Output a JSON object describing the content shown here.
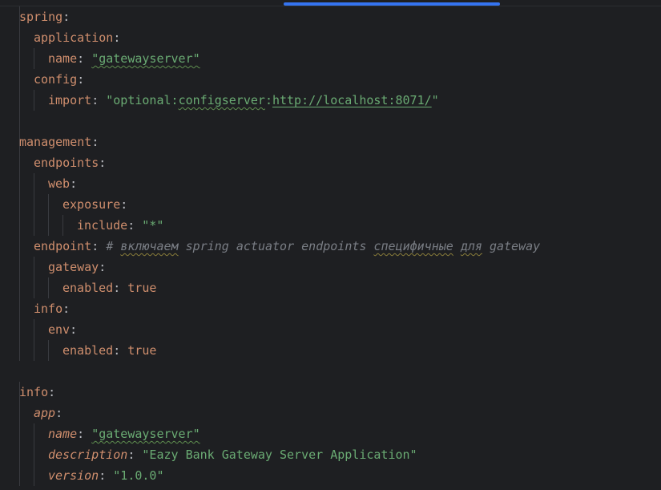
{
  "editor": {
    "accent": "#3574f0",
    "colors": {
      "background": "#1e1f22",
      "key": "#cf8e6d",
      "string": "#6aab73",
      "comment": "#7a7e85",
      "text": "#bcbec4"
    },
    "lines": {
      "l1": {
        "key": "spring"
      },
      "l2": {
        "key": "application"
      },
      "l3": {
        "key": "name",
        "value": "\"gatewayserver\""
      },
      "l4": {
        "key": "config"
      },
      "l5": {
        "key": "import",
        "v_prefix": "\"optional:",
        "v_cfg": "configserver",
        "v_colon": ":",
        "v_url": "http://localhost:8071/",
        "v_quote": "\""
      },
      "l7": {
        "key": "management"
      },
      "l8": {
        "key": "endpoints"
      },
      "l9": {
        "key": "web"
      },
      "l10": {
        "key": "exposure"
      },
      "l11": {
        "key": "include",
        "value": "\"*\""
      },
      "l12": {
        "key": "endpoint",
        "c_hash": "# ",
        "c_w1": "включаем",
        "c_mid": " spring actuator endpoints ",
        "c_w2": "специфичные",
        "c_sp": " ",
        "c_w3": "для",
        "c_end": " gateway"
      },
      "l13": {
        "key": "gateway"
      },
      "l14": {
        "key": "enabled",
        "value": "true"
      },
      "l15": {
        "key": "info"
      },
      "l16": {
        "key": "env"
      },
      "l17": {
        "key": "enabled",
        "value": "true"
      },
      "l19": {
        "key": "info"
      },
      "l20": {
        "key": "app"
      },
      "l21": {
        "key": "name",
        "value": "\"gatewayserver\""
      },
      "l22": {
        "key": "description",
        "value": "\"Eazy Bank Gateway Server Application\""
      },
      "l23": {
        "key": "version",
        "value": "\"1.0.0\""
      }
    }
  }
}
